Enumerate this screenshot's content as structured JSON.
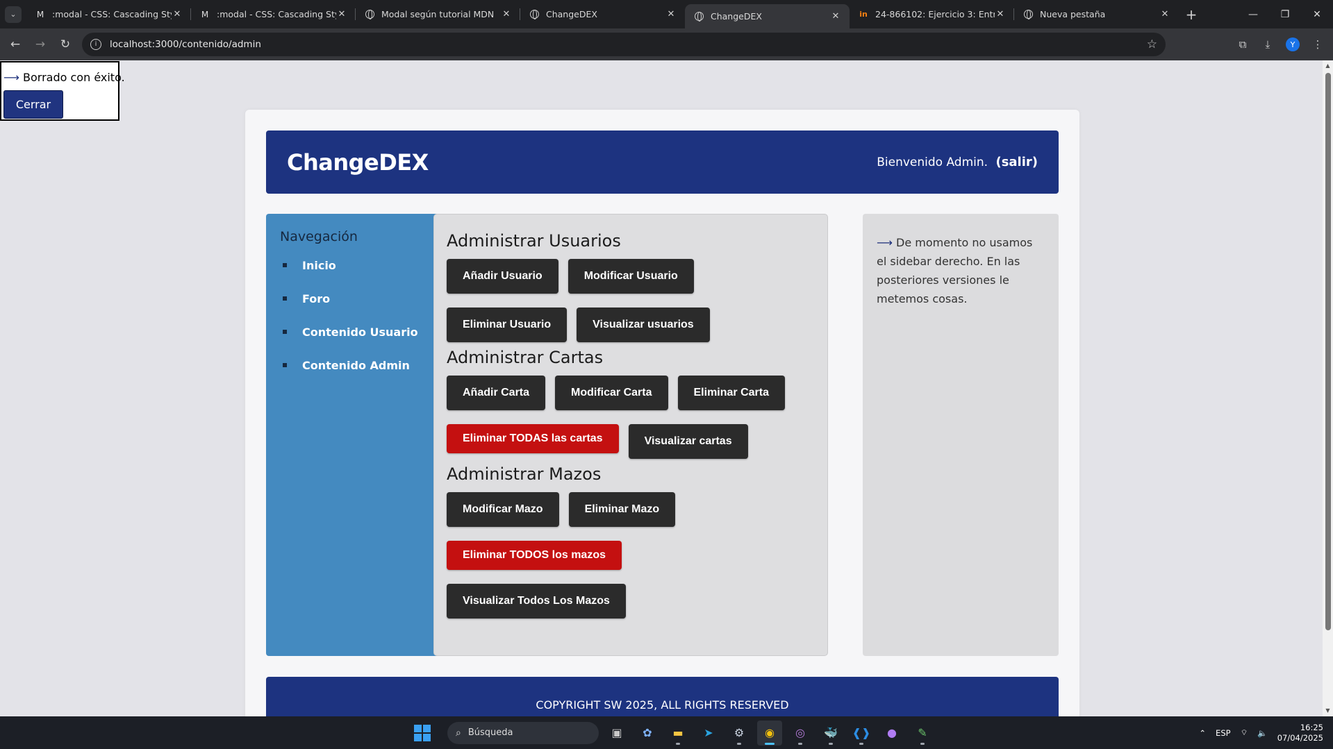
{
  "browser": {
    "tabs": [
      {
        "icon": "M",
        "title": ":modal - CSS: Cascading Style S",
        "active": false
      },
      {
        "icon": "M",
        "title": ":modal - CSS: Cascading Style S",
        "active": false
      },
      {
        "icon": "globe",
        "title": "Modal según tutorial MDN",
        "active": false
      },
      {
        "icon": "globe",
        "title": "ChangeDEX",
        "active": false
      },
      {
        "icon": "globe",
        "title": "ChangeDEX",
        "active": true
      },
      {
        "icon": "in",
        "title": "24-866102: Ejercicio 3: Entrega",
        "active": false
      },
      {
        "icon": "chrome",
        "title": "Nueva pestaña",
        "active": false
      }
    ],
    "url": "localhost:3000/contenido/admin",
    "profile_initial": "Y"
  },
  "modal": {
    "arrow": "⟶",
    "message": "Borrado con éxito.",
    "close_label": "Cerrar"
  },
  "header": {
    "logo": "ChangeDEX",
    "welcome": "Bienvenido Admin.",
    "logout": "(salir)"
  },
  "nav": {
    "title": "Navegación",
    "items": [
      {
        "label": "Inicio"
      },
      {
        "label": "Foro"
      },
      {
        "label": "Contenido Usuario"
      },
      {
        "label": "Contenido Admin"
      }
    ]
  },
  "main": {
    "users": {
      "title": "Administrar Usuarios",
      "add": "Añadir Usuario",
      "edit": "Modificar Usuario",
      "delete": "Eliminar Usuario",
      "view": "Visualizar usuarios"
    },
    "cards": {
      "title": "Administrar Cartas",
      "add": "Añadir Carta",
      "edit": "Modificar Carta",
      "delete": "Eliminar Carta",
      "delete_all": "Eliminar TODAS las cartas",
      "view": "Visualizar cartas"
    },
    "decks": {
      "title": "Administrar Mazos",
      "edit": "Modificar Mazo",
      "delete": "Eliminar Mazo",
      "delete_all": "Eliminar TODOS los mazos",
      "view_all": "Visualizar Todos Los Mazos"
    }
  },
  "sidebar": {
    "arrow": "⟶",
    "text": "De momento no usamos el sidebar derecho. En las posteriores versiones le metemos cosas."
  },
  "footer": {
    "text": "COPYRIGHT SW 2025, ALL RIGHTS RESERVED"
  },
  "taskbar": {
    "search_placeholder": "Búsqueda",
    "language": "ESP",
    "time": "16:25",
    "date": "07/04/2025"
  },
  "colors": {
    "brand_blue": "#1d3380",
    "nav_blue": "#448ac0",
    "danger_red": "#c41010",
    "button_dark": "#2b2b2b"
  }
}
